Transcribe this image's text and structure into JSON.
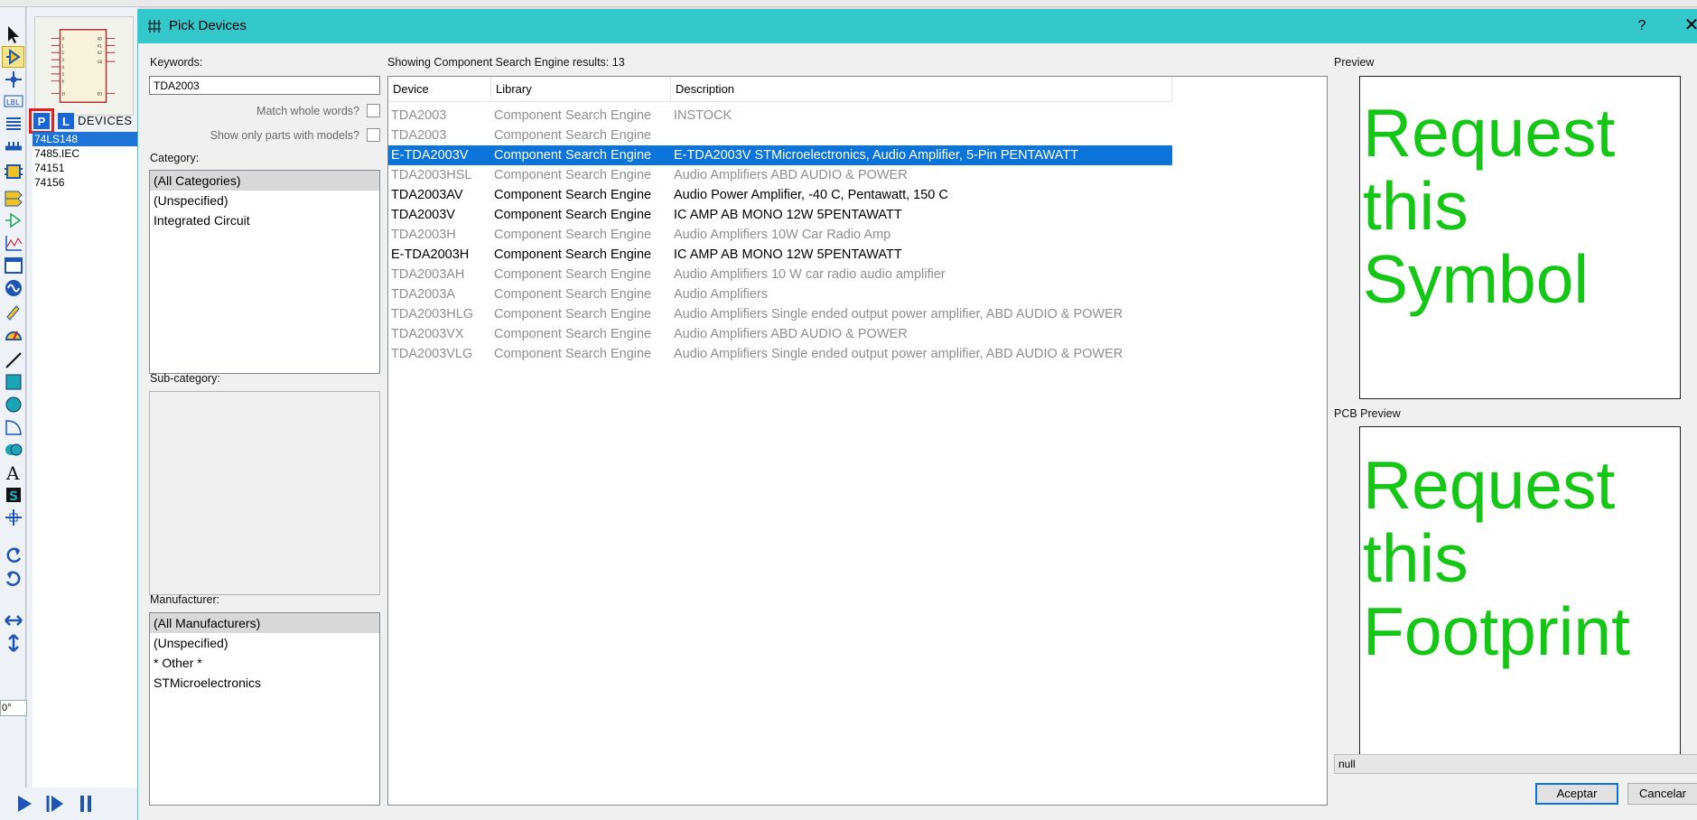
{
  "dialog": {
    "title": "Pick Devices",
    "help": "?",
    "close": "✕"
  },
  "left_panel": {
    "keywords_label": "Keywords:",
    "keywords_value": "TDA2003",
    "match_whole_words": "Match whole words?",
    "show_only_models": "Show only parts with models?",
    "category_label": "Category:",
    "categories": [
      "(All Categories)",
      "(Unspecified)",
      "Integrated Circuit"
    ],
    "subcategory_label": "Sub-category:",
    "manufacturer_label": "Manufacturer:",
    "manufacturers": [
      "(All Manufacturers)",
      "(Unspecified)",
      "* Other *",
      "STMicroelectronics"
    ]
  },
  "results": {
    "summary": "Showing Component Search Engine results: 13",
    "columns": [
      "Device",
      "Library",
      "Description"
    ],
    "rows": [
      {
        "device": "TDA2003",
        "library": "Component Search Engine",
        "description": "INSTOCK",
        "style": "gray"
      },
      {
        "device": "TDA2003",
        "library": "Component Search Engine",
        "description": "",
        "style": "gray"
      },
      {
        "device": "E-TDA2003V",
        "library": "Component Search Engine",
        "description": "E-TDA2003V STMicroelectronics, Audio Amplifier, 5-Pin PENTAWATT",
        "style": "sel"
      },
      {
        "device": "TDA2003HSL",
        "library": "Component Search Engine",
        "description": "Audio Amplifiers ABD AUDIO & POWER",
        "style": "gray"
      },
      {
        "device": "TDA2003AV",
        "library": "Component Search Engine",
        "description": "Audio Power Amplifier, -40 C, Pentawatt, 150 C",
        "style": "black"
      },
      {
        "device": "TDA2003V",
        "library": "Component Search Engine",
        "description": "IC AMP AB MONO 12W 5PENTAWATT",
        "style": "black"
      },
      {
        "device": "TDA2003H",
        "library": "Component Search Engine",
        "description": "Audio Amplifiers 10W Car Radio Amp",
        "style": "gray"
      },
      {
        "device": "E-TDA2003H",
        "library": "Component Search Engine",
        "description": "IC AMP AB MONO 12W 5PENTAWATT",
        "style": "black"
      },
      {
        "device": "TDA2003AH",
        "library": "Component Search Engine",
        "description": "Audio Amplifiers 10 W car radio audio amplifier",
        "style": "gray"
      },
      {
        "device": "TDA2003A",
        "library": "Component Search Engine",
        "description": "Audio Amplifiers",
        "style": "gray"
      },
      {
        "device": "TDA2003HLG",
        "library": "Component Search Engine",
        "description": "Audio Amplifiers Single ended output power amplifier, ABD AUDIO & POWER",
        "style": "gray"
      },
      {
        "device": "TDA2003VX",
        "library": "Component Search Engine",
        "description": "Audio Amplifiers ABD AUDIO & POWER",
        "style": "gray"
      },
      {
        "device": "TDA2003VLG",
        "library": "Component Search Engine",
        "description": "Audio Amplifiers Single ended output power amplifier, ABD AUDIO & POWER",
        "style": "gray"
      }
    ]
  },
  "preview": {
    "label": "Preview",
    "text": "Request\nthis\nSymbol",
    "pcb_label": "PCB Preview",
    "pcb_text": "Request\nthis\nFootprint",
    "status": "null"
  },
  "buttons": {
    "ok": "Aceptar",
    "cancel": "Cancelar"
  },
  "background_app": {
    "devices_title": "DEVICES",
    "p_button": "P",
    "l_button": "L",
    "devices": [
      "74LS148",
      "7485.IEC",
      "74151",
      "74156"
    ],
    "angle": "0°"
  },
  "colors": {
    "titlebar": "#33c9cc",
    "selection": "#0a74db",
    "preview_text": "#14c714"
  }
}
